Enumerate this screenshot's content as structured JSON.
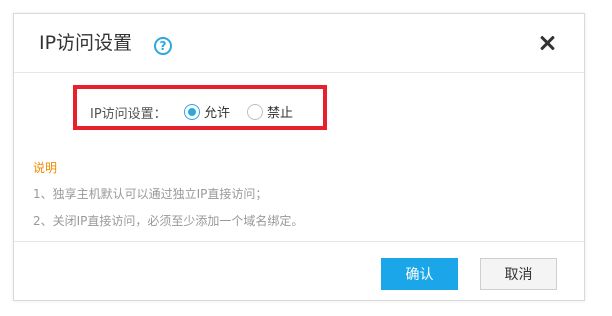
{
  "dialog": {
    "title": "IP访问设置",
    "help_icon_glyph": "?",
    "icons": [
      "help-icon",
      "close-icon"
    ]
  },
  "setting": {
    "label": "IP访问设置：",
    "options": [
      {
        "label": "允许",
        "checked": true
      },
      {
        "label": "禁止",
        "checked": false
      }
    ]
  },
  "notes": {
    "title": "说明",
    "lines": [
      "1、独享主机默认可以通过独立IP直接访问；",
      "2、关闭IP直接访问，必须至少添加一个域名绑定。"
    ]
  },
  "buttons": {
    "confirm": "确认",
    "cancel": "取消"
  },
  "colors": {
    "accent": "#1aa6e8",
    "highlight": "#e8202d",
    "note_title": "#f08a00"
  }
}
